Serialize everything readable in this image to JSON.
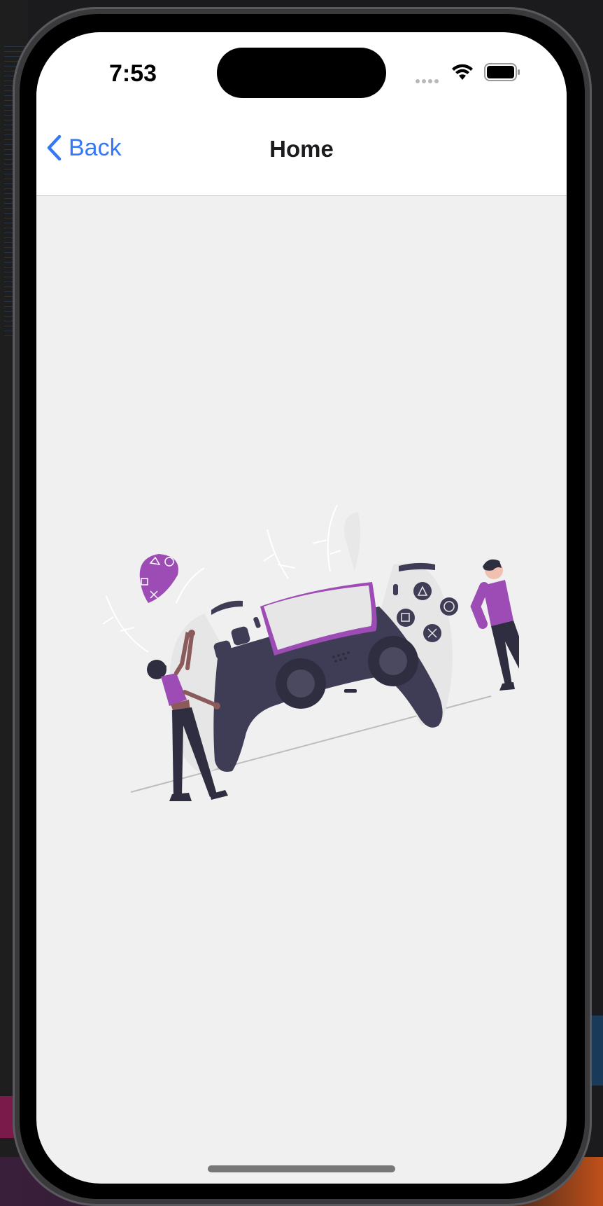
{
  "status_bar": {
    "time": "7:53",
    "icons": [
      "signal-dots-icon",
      "wifi-icon",
      "battery-icon"
    ]
  },
  "nav": {
    "back_label": "Back",
    "title": "Home"
  },
  "content": {
    "illustration": "game-controller-illustration"
  },
  "colors": {
    "accent": "#3478f6",
    "brand_purple": "#9d4bb5",
    "dark": "#3f3d56",
    "background": "#f0f0f0"
  }
}
